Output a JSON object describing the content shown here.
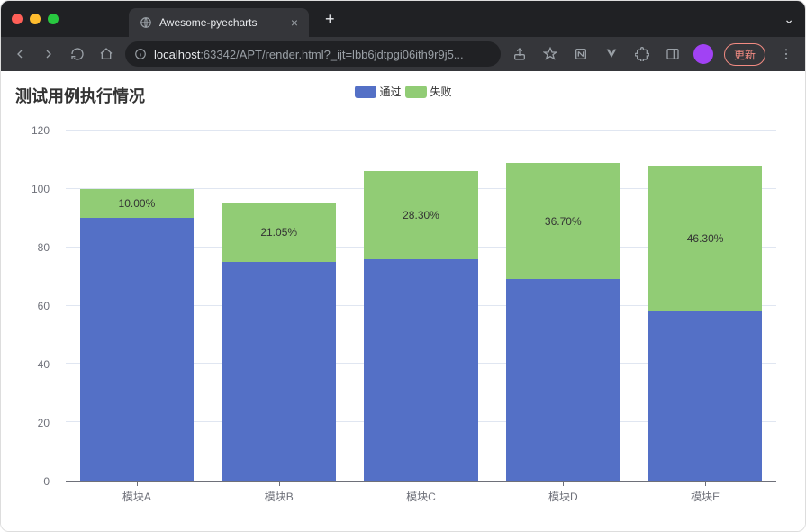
{
  "browser": {
    "tab_title": "Awesome-pyecharts",
    "url_host": "localhost",
    "url_path": ":63342/APT/render.html?_ijt=lbb6jdtpgi06ith9r9j5...",
    "update_label": "更新"
  },
  "chart_data": {
    "type": "bar",
    "stacked": true,
    "title": "测试用例执行情况",
    "categories": [
      "模块A",
      "模块B",
      "模块C",
      "模块D",
      "模块E"
    ],
    "series": [
      {
        "name": "通过",
        "color": "#5470c6",
        "values": [
          90,
          75,
          76,
          69,
          58
        ]
      },
      {
        "name": "失败",
        "color": "#91cc75",
        "values": [
          10,
          20,
          30,
          40,
          50
        ],
        "labels": [
          "10.00%",
          "21.05%",
          "28.30%",
          "36.70%",
          "46.30%"
        ]
      }
    ],
    "ylim": [
      0,
      120
    ],
    "y_ticks": [
      0,
      20,
      40,
      60,
      80,
      100,
      120
    ],
    "xlabel": "",
    "ylabel": ""
  }
}
